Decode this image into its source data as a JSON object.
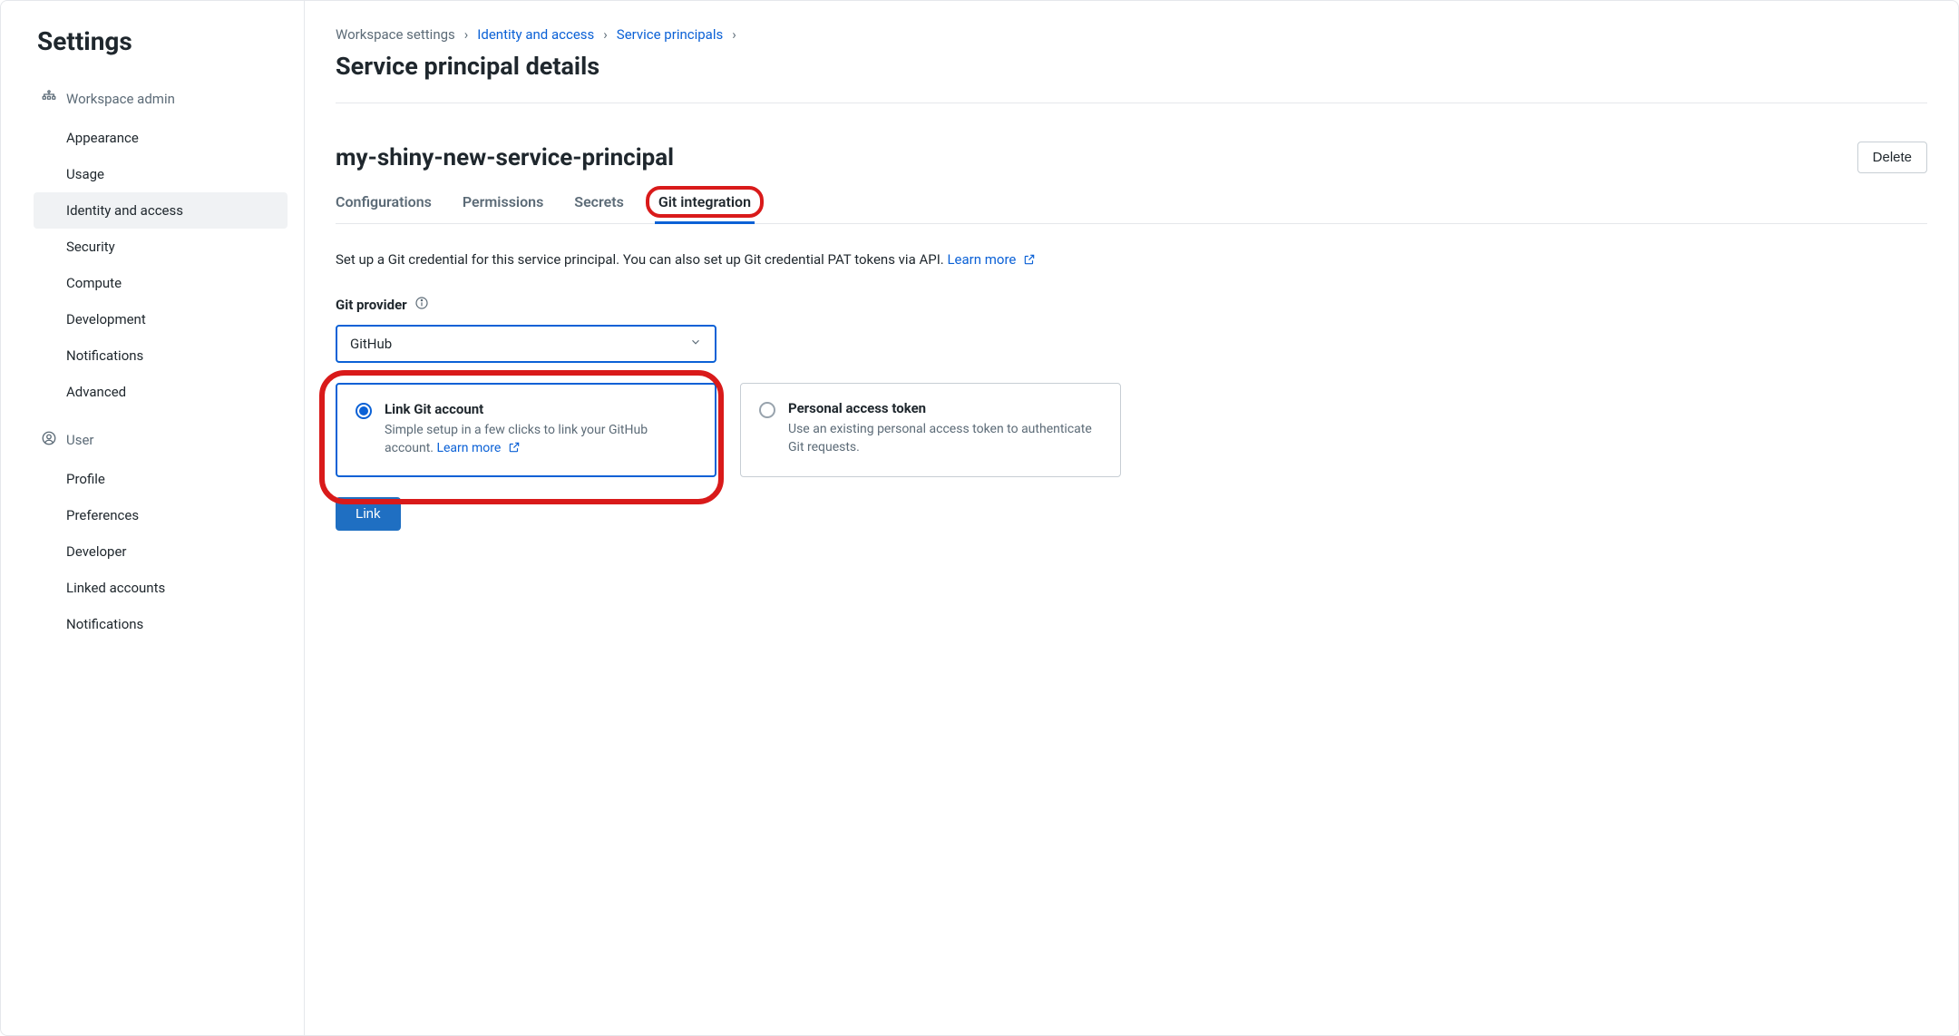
{
  "sidebar": {
    "title": "Settings",
    "sections": [
      {
        "header": "Workspace admin",
        "icon": "workspace-admin-icon",
        "items": [
          {
            "label": "Appearance",
            "active": false
          },
          {
            "label": "Usage",
            "active": false
          },
          {
            "label": "Identity and access",
            "active": true
          },
          {
            "label": "Security",
            "active": false
          },
          {
            "label": "Compute",
            "active": false
          },
          {
            "label": "Development",
            "active": false
          },
          {
            "label": "Notifications",
            "active": false
          },
          {
            "label": "Advanced",
            "active": false
          }
        ]
      },
      {
        "header": "User",
        "icon": "user-icon",
        "items": [
          {
            "label": "Profile",
            "active": false
          },
          {
            "label": "Preferences",
            "active": false
          },
          {
            "label": "Developer",
            "active": false
          },
          {
            "label": "Linked accounts",
            "active": false
          },
          {
            "label": "Notifications",
            "active": false
          }
        ]
      }
    ]
  },
  "breadcrumbs": [
    {
      "label": "Workspace settings",
      "link": false
    },
    {
      "label": "Identity and access",
      "link": true
    },
    {
      "label": "Service principals",
      "link": true
    }
  ],
  "page_title": "Service principal details",
  "entity_name": "my-shiny-new-service-principal",
  "delete_label": "Delete",
  "tabs": [
    {
      "label": "Configurations",
      "active": false
    },
    {
      "label": "Permissions",
      "active": false
    },
    {
      "label": "Secrets",
      "active": false
    },
    {
      "label": "Git integration",
      "active": true,
      "highlighted": true
    }
  ],
  "description": "Set up a Git credential for this service principal. You can also set up Git credential PAT tokens via API. ",
  "learn_more": "Learn more",
  "git_provider": {
    "label": "Git provider",
    "value": "GitHub"
  },
  "auth_options": [
    {
      "title": "Link Git account",
      "desc_pre": "Simple setup in a few clicks to link your GitHub account. ",
      "learn_more": "Learn more",
      "selected": true,
      "highlighted": true
    },
    {
      "title": "Personal access token",
      "desc_pre": "Use an existing personal access token to authenticate Git requests.",
      "learn_more": "",
      "selected": false,
      "highlighted": false
    }
  ],
  "link_button": "Link"
}
